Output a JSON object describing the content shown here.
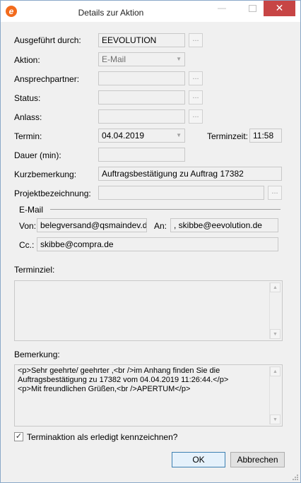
{
  "window": {
    "title": "Details zur Aktion",
    "app_icon_letter": "e",
    "minimize_glyph": "—",
    "close_glyph": "✕"
  },
  "form": {
    "ausgefuehrt": {
      "label": "Ausgeführt durch:",
      "value": "EEVOLUTION",
      "button": "..."
    },
    "aktion": {
      "label": "Aktion:",
      "value": "E-Mail"
    },
    "ansprechpartner": {
      "label": "Ansprechpartner:",
      "value": "",
      "button": "..."
    },
    "status": {
      "label": "Status:",
      "value": "",
      "button": "..."
    },
    "anlass": {
      "label": "Anlass:",
      "value": "",
      "button": "..."
    },
    "termin": {
      "label": "Termin:",
      "value": "04.04.2019"
    },
    "terminzeit": {
      "label": "Terminzeit:",
      "value": "11:58"
    },
    "dauer": {
      "label": "Dauer (min):",
      "value": ""
    },
    "kurzbemerkung": {
      "label": "Kurzbemerkung:",
      "value": "Auftragsbestätigung zu Auftrag 17382"
    },
    "projekt": {
      "label": "Projektbezeichnung:",
      "value": "",
      "button": "..."
    }
  },
  "email": {
    "group_label": "E-Mail",
    "von_label": "Von:",
    "von_value": "belegversand@qsmaindev.de",
    "an_label": "An:",
    "an_value": ", skibbe@eevolution.de",
    "cc_label": "Cc.:",
    "cc_value": "skibbe@compra.de"
  },
  "terminziel": {
    "label": "Terminziel:",
    "value": ""
  },
  "bemerkung": {
    "label": "Bemerkung:",
    "value": "<p>Sehr geehrte/ geehrter ,<br />im Anhang finden Sie die\nAuftragsbestätigung zu 17382 vom 04.04.2019 11:26:44.</p>\n<p>Mit freundlichen Grüßen,<br />APERTUM</p>"
  },
  "done": {
    "label": "Terminaktion als erledigt kennzeichnen?",
    "checked": true,
    "mark": "✓"
  },
  "buttons": {
    "ok": "OK",
    "cancel": "Abbrechen"
  },
  "icons": {
    "scroll_up": "▲",
    "scroll_down": "▼",
    "dropdown": "▼"
  }
}
